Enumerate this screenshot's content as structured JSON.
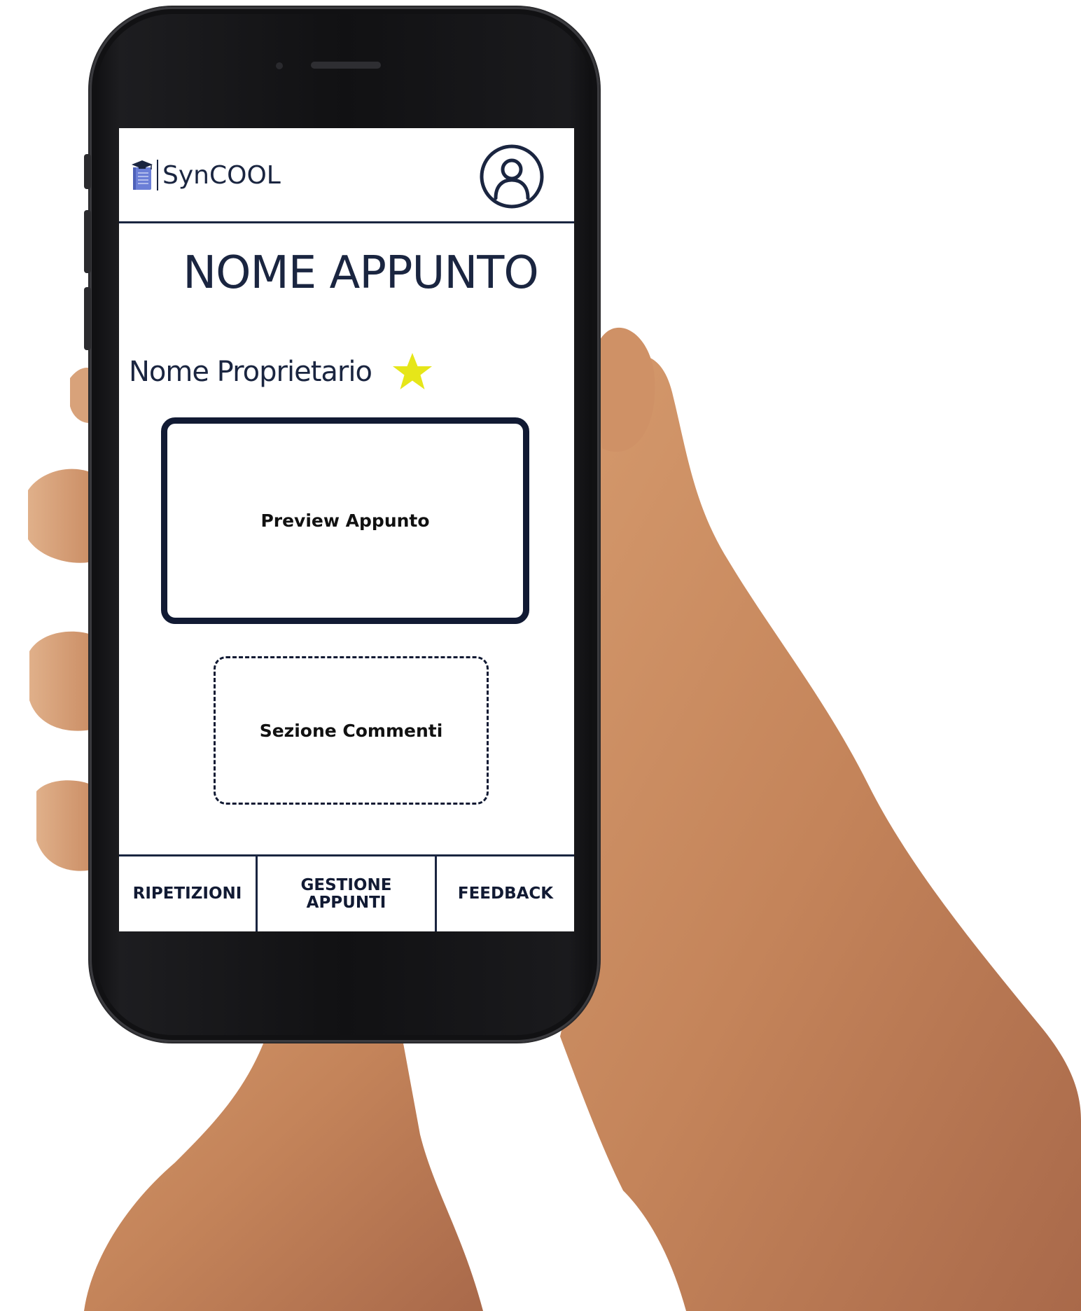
{
  "app": {
    "name": "SynCOOL"
  },
  "header": {
    "logo_icon": "notebook-with-graduation-cap-icon",
    "profile_icon": "user-circle-icon"
  },
  "page": {
    "title": "NOME APPUNTO",
    "owner_name": "Nome Proprietario",
    "favorite_icon": "star-icon",
    "star_color": "#e6e619",
    "preview_label": "Preview Appunto",
    "comments_label": "Sezione Commenti"
  },
  "bottom_nav": {
    "items": [
      {
        "label": "RIPETIZIONI"
      },
      {
        "label_line1": "GESTIONE",
        "label_line2": "APPUNTI"
      },
      {
        "label": "FEEDBACK"
      }
    ]
  },
  "colors": {
    "ink": "#1a2540",
    "logo_blue": "#6b7fd7",
    "skin": "#c98a5e"
  }
}
